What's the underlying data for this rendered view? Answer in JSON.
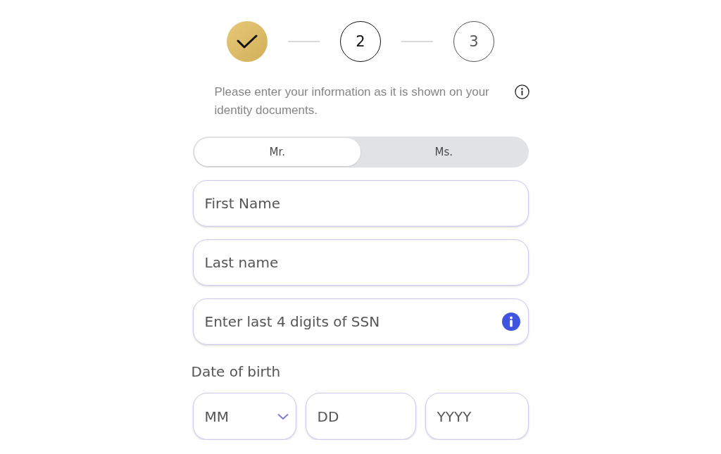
{
  "stepper": {
    "steps": [
      {
        "completed": true,
        "current": false
      },
      {
        "completed": false,
        "current": true,
        "label": "2"
      },
      {
        "completed": false,
        "current": false,
        "label": "3"
      }
    ]
  },
  "notice": {
    "text": "Please enter your information as it is shown on your identity documents."
  },
  "title_toggle": {
    "options": [
      {
        "label": "Mr.",
        "selected": true
      },
      {
        "label": "Ms.",
        "selected": false
      }
    ]
  },
  "fields": [
    {
      "kind": "plain",
      "placeholder": "First Name"
    },
    {
      "kind": "plain",
      "placeholder": "Last name"
    },
    {
      "kind": "info",
      "placeholder": "Enter last 4 digits of SSN"
    }
  ],
  "date_of_birth": {
    "label": "Date of birth",
    "parts": [
      {
        "kind": "select",
        "placeholder": "MM"
      },
      {
        "kind": "text",
        "placeholder": "DD"
      },
      {
        "kind": "text",
        "placeholder": "YYYY"
      }
    ]
  }
}
